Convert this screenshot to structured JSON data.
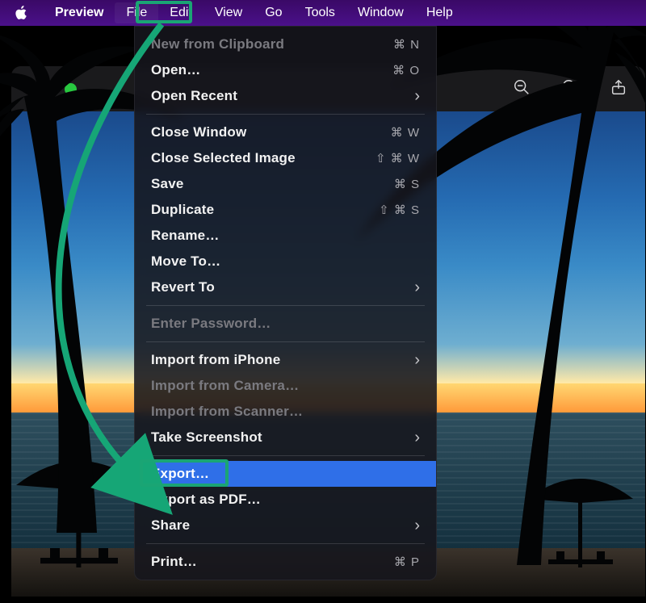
{
  "menubar": {
    "appname": "Preview",
    "items": [
      "File",
      "Edit",
      "View",
      "Go",
      "Tools",
      "Window",
      "Help"
    ],
    "active": "File"
  },
  "file_menu": {
    "items": [
      {
        "label": "New from Clipboard",
        "shortcut": "⌘ N",
        "disabled": true
      },
      {
        "label": "Open…",
        "shortcut": "⌘ O"
      },
      {
        "label": "Open Recent",
        "submenu": true
      },
      {
        "sep": true
      },
      {
        "label": "Close Window",
        "shortcut": "⌘ W"
      },
      {
        "label": "Close Selected Image",
        "shortcut": "⇧ ⌘ W"
      },
      {
        "label": "Save",
        "shortcut": "⌘ S"
      },
      {
        "label": "Duplicate",
        "shortcut": "⇧ ⌘ S"
      },
      {
        "label": "Rename…"
      },
      {
        "label": "Move To…"
      },
      {
        "label": "Revert To",
        "submenu": true
      },
      {
        "sep": true
      },
      {
        "label": "Enter Password…",
        "disabled": true
      },
      {
        "sep": true
      },
      {
        "label": "Import from iPhone",
        "submenu": true
      },
      {
        "label": "Import from Camera…",
        "disabled": true
      },
      {
        "label": "Import from Scanner…",
        "disabled": true
      },
      {
        "label": "Take Screenshot",
        "submenu": true
      },
      {
        "sep": true
      },
      {
        "label": "Export…",
        "selected": true
      },
      {
        "label": "Export as PDF…"
      },
      {
        "label": "Share",
        "submenu": true
      },
      {
        "sep": true
      },
      {
        "label": "Print…",
        "shortcut": "⌘ P"
      }
    ]
  },
  "annotation": {
    "highlight_menu": "File",
    "highlight_item": "Export…",
    "arrow_color": "#16a676"
  },
  "toolbar": {
    "icons": [
      "zoom-out",
      "zoom-in",
      "share"
    ]
  }
}
